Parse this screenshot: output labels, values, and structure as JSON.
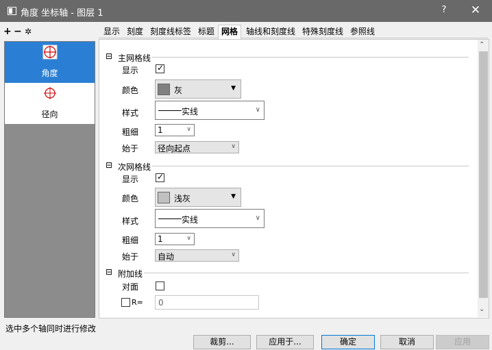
{
  "window": {
    "title": "角度 坐标轴 - 图层 1",
    "help": "?",
    "close": "✕"
  },
  "toolbar": {
    "add": "+",
    "remove": "−",
    "settings": "✲"
  },
  "axes": [
    {
      "label": "角度",
      "selected": true
    },
    {
      "label": "径向",
      "selected": false
    }
  ],
  "tabs": [
    "显示",
    "刻度",
    "刻度线标签",
    "标题",
    "网格",
    "轴线和刻度线",
    "特殊刻度线",
    "参照线"
  ],
  "active_tab": "网格",
  "major": {
    "header": "主网格线",
    "collapse": "⊟",
    "show_label": "显示",
    "show_checked": true,
    "color_label": "颜色",
    "color_name": "灰",
    "color_hex": "#808080",
    "style_label": "样式",
    "style_name": "实线",
    "width_label": "粗细",
    "width_value": "1",
    "start_label": "始于",
    "start_value": "径向起点"
  },
  "minor": {
    "header": "次网格线",
    "collapse": "⊟",
    "show_label": "显示",
    "show_checked": true,
    "color_label": "颜色",
    "color_name": "浅灰",
    "color_hex": "#c0c0c0",
    "style_label": "样式",
    "style_name": "实线",
    "width_label": "粗细",
    "width_value": "1",
    "start_label": "始于",
    "start_value": "自动"
  },
  "additional": {
    "header": "附加线",
    "collapse": "⊟",
    "opposite_label": "对面",
    "r_label": "R=",
    "r_value": "0"
  },
  "status": "选中多个轴同时进行修改",
  "buttons": {
    "crop": "裁剪...",
    "apply_to": "应用于...",
    "ok": "确定",
    "cancel": "取消",
    "apply": "应用"
  }
}
